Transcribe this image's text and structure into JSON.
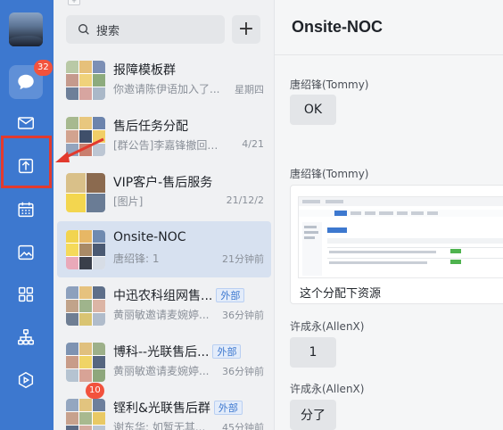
{
  "rail": {
    "message_badge": "32",
    "items": [
      {
        "icon": "chat-bubble-icon"
      },
      {
        "icon": "mail-icon"
      },
      {
        "icon": "workbench-icon"
      },
      {
        "icon": "calendar-icon"
      },
      {
        "icon": "photo-icon"
      },
      {
        "icon": "apps-grid-icon"
      },
      {
        "icon": "org-chart-icon"
      },
      {
        "icon": "play-box-icon"
      }
    ],
    "accent": "#3d78cf",
    "annotation_color": "#e23a2e"
  },
  "list": {
    "search_placeholder": "搜索",
    "add_label": "+",
    "conversations": [
      {
        "name": "报障模板群",
        "preview": "你邀请陈伊语加入了...",
        "time": "星期四"
      },
      {
        "name": "售后任务分配",
        "preview": "[群公告]李嘉锋撤回了...",
        "time": "4/21"
      },
      {
        "name": "VIP客户-售后服务",
        "preview": "[图片]",
        "time": "21/12/2"
      },
      {
        "name": "Onsite-NOC",
        "preview": "唐绍锋: 1",
        "time": "21分钟前"
      },
      {
        "name": "中迅农科组网售...",
        "tag": "外部",
        "preview": "黄丽敏邀请麦婉婷...",
        "time": "36分钟前"
      },
      {
        "name": "博科--光联售后...",
        "tag": "外部",
        "preview": "黄丽敏邀请麦婉婷...",
        "time": "36分钟前"
      },
      {
        "name": "铿利&光联售后群",
        "tag": "外部",
        "preview": "谢东华: 如暂无其...",
        "time": "45分钟前",
        "badge": "10"
      }
    ]
  },
  "chat": {
    "title": "Onsite-NOC",
    "messages": [
      {
        "sender": "唐绍锋(Tommy)",
        "text": "OK"
      },
      {
        "sender": "唐绍锋(Tommy)",
        "caption": "这个分配下资源"
      },
      {
        "sender": "许成永(AllenX)",
        "text": "1"
      },
      {
        "sender": "许成永(AllenX)",
        "text": "分了"
      }
    ]
  }
}
